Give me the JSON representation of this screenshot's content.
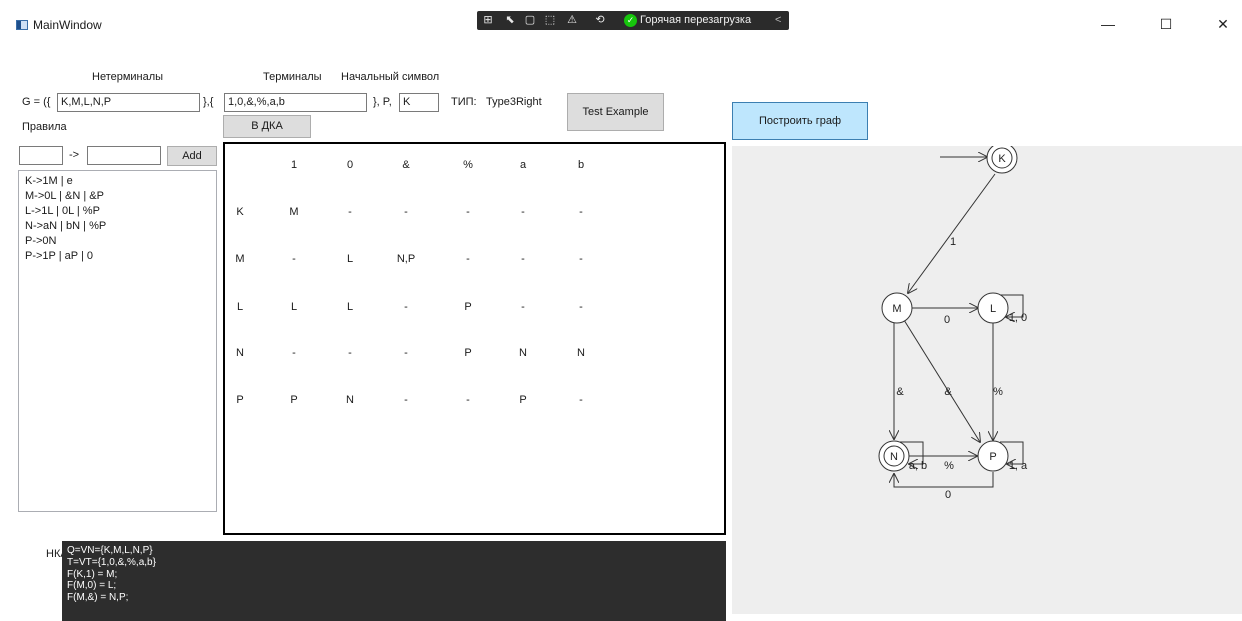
{
  "window": {
    "title": "MainWindow",
    "minimize": "—",
    "maximize": "☐",
    "close": "✕"
  },
  "devbar": {
    "hot_reload_label": "Горячая перезагрузка",
    "hot_reload_check": "✓",
    "collapse": "<"
  },
  "form": {
    "nonterminals_label": "Нетерминалы",
    "terminals_label": "Терминалы",
    "start_symbol_label": "Начальный символ",
    "grammar_prefix": "G = ({",
    "nonterminals_value": "K,M,L,N,P",
    "separator1": "},{",
    "terminals_value": "1,0,&,%,a,b",
    "separator2": "}, P,",
    "start_symbol_value": "K",
    "type_label": "ТИП:",
    "type_value": "Type3Right",
    "test_example_button": "Test Example",
    "rules_label": "Правила",
    "to_dfa_button": "В ДКА",
    "rule_left_value": "",
    "arrow": "->",
    "rule_right_value": "",
    "add_button": "Add"
  },
  "rules": [
    "K->1M | e",
    "M->0L | &N | &P",
    "L->1L | 0L | %P",
    "N->aN | bN | %P",
    "P->0N",
    "P->1P | aP | 0"
  ],
  "table": {
    "headers": [
      "1",
      "0",
      "&",
      "%",
      "a",
      "b"
    ],
    "rows": [
      {
        "state": "K",
        "cells": [
          "M",
          "-",
          "-",
          "-",
          "-",
          "-"
        ]
      },
      {
        "state": "M",
        "cells": [
          "-",
          "L",
          "N,P",
          "-",
          "-",
          "-"
        ]
      },
      {
        "state": "L",
        "cells": [
          "L",
          "L",
          "-",
          "P",
          "-",
          "-"
        ]
      },
      {
        "state": "N",
        "cells": [
          "-",
          "-",
          "-",
          "P",
          "N",
          "N"
        ]
      },
      {
        "state": "P",
        "cells": [
          "P",
          "N",
          "-",
          "-",
          "P",
          "-"
        ]
      }
    ]
  },
  "nfa": {
    "label": "НКА:",
    "lines": [
      "Q=VN={K,M,L,N,P}",
      "T=VT={1,0,&,%,a,b}",
      "F(K,1) = M;",
      "F(M,0) = L;",
      "F(M,&) = N,P;"
    ]
  },
  "graph": {
    "build_button": "Построить граф",
    "nodes": {
      "K": "K",
      "M": "M",
      "L": "L",
      "N": "N",
      "P": "P"
    },
    "edge_labels": {
      "k_m": "1",
      "m_l": "0",
      "l_loop": "1, 0",
      "m_n": "&",
      "m_p": "&",
      "l_p": "%",
      "n_loop": "a, b",
      "n_p": "%",
      "p_n": "0",
      "p_loop": "1, a"
    }
  }
}
